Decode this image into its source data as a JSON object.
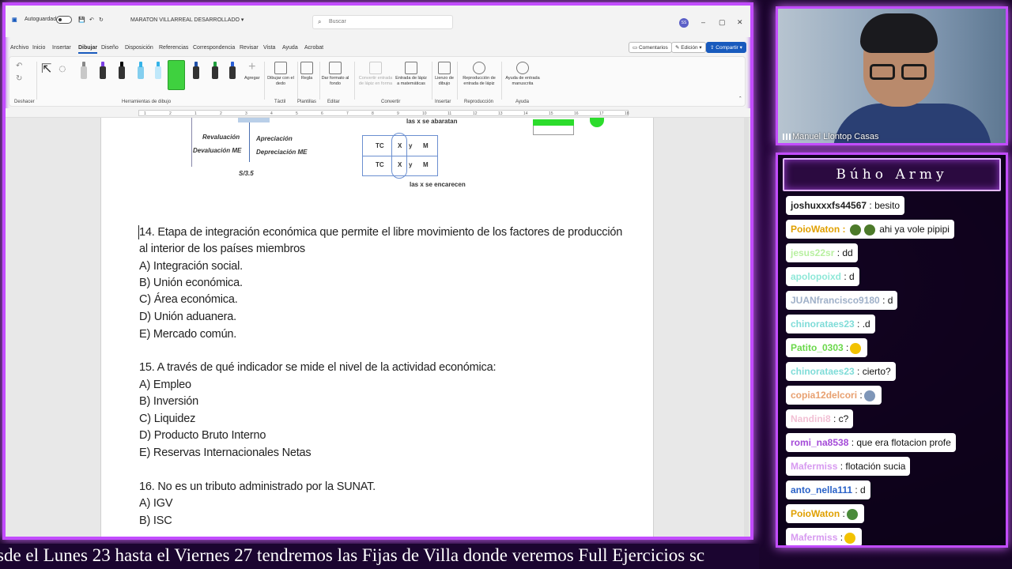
{
  "word": {
    "autosave_label": "Autoguardado",
    "doc_title": "MARATON VILLARREAL DESARROLLADO",
    "search_placeholder": "Buscar",
    "avatar_initials": "SS",
    "menu": [
      "Archivo",
      "Inicio",
      "Insertar",
      "Dibujar",
      "Diseño",
      "Disposición",
      "Referencias",
      "Correspondencia",
      "Revisar",
      "Vista",
      "Ayuda",
      "Acrobat"
    ],
    "active_menu": "Dibujar",
    "comments_label": "Comentarios",
    "edit_label": "Edición",
    "share_label": "Compartir",
    "ribbon": {
      "undo_group": "Deshacer",
      "drawing_tools_group": "Herramientas de dibujo",
      "add_label": "Agregar",
      "draw_finger_label": "Dibujar con el dedo",
      "ruler_label": "Regla",
      "background_format_label": "Dar formato al fondo",
      "ink_to_shape_label": "Convertir entrada de lápiz en forma",
      "ink_to_math_label": "Entrada de lápiz a matemáticas",
      "canvas_label": "Lienzo de dibujo",
      "replay_label": "Reproducción de entrada de lápiz",
      "ink_help_label": "Ayuda de entrada manuscrita",
      "groups": {
        "tactil": "Táctil",
        "plantillas": "Plantillas",
        "editar": "Editar",
        "convertir": "Convertir",
        "insertar": "Insertar",
        "reproduccion": "Reproducción",
        "ayuda": "Ayuda"
      },
      "pen_colors": [
        "#555555",
        "#7b3fe4",
        "#000000",
        "#35b3e8",
        "#35b3e8",
        "#3fd13f",
        "#1e4fa8",
        "#1f9e3c",
        "#2a5fd6"
      ]
    },
    "ruler_numbers": [
      "1",
      "2",
      "1",
      "2",
      "3",
      "4",
      "5",
      "6",
      "7",
      "8",
      "9",
      "10",
      "11",
      "12",
      "13",
      "14",
      "15",
      "16",
      "17",
      "18"
    ],
    "figure": {
      "revaluacion": "Revaluación",
      "devaluacion": "Devaluación ME",
      "apreciacion": "Apreciación",
      "depreciacion": "Depreciación ME",
      "rate": "S/3.5",
      "top_note": "las x se abaratan",
      "bottom_note": "las x se encarecen",
      "row_labels": [
        "TC",
        "X",
        "y",
        "M"
      ]
    },
    "questions": [
      "14. Etapa de integración económica que permite el libre movimiento de los factores de producción",
      "al interior de los países miembros",
      "A) Integración social.",
      "B) Unión económica.",
      "C) Área económica.",
      "D) Unión aduanera.",
      "E) Mercado común.",
      "15. A través de qué indicador se mide el nivel de la actividad económica:",
      "A) Empleo",
      "B) Inversión",
      "C) Liquidez",
      "D) Producto Bruto Interno",
      "E) Reservas Internacionales Netas",
      "16. No es un tributo administrado por la SUNAT.",
      "A) IGV",
      "B) ISC"
    ]
  },
  "webcam": {
    "name": "Manuel Llontop Casas"
  },
  "chat": {
    "title": "Búho Army",
    "messages": [
      {
        "user": "joshuxxxfs44567",
        "color": "#222222",
        "text": ": besito",
        "emotes": []
      },
      {
        "user": "PoioWaton",
        "color": "#e0a000",
        "text": "ahi ya vole pipipi",
        "emotes": [
          "#4c7a2a",
          "#4c7a2a"
        ]
      },
      {
        "user": "jesus22sr",
        "color": "#b8f0a0",
        "text": ": dd",
        "emotes": []
      },
      {
        "user": "apolopoixd",
        "color": "#8fe8d8",
        "text": ": d",
        "emotes": []
      },
      {
        "user": "JUANfrancisco9180",
        "color": "#9fb0c8",
        "text": ": d",
        "emotes": []
      },
      {
        "user": "chinorataes23",
        "color": "#7fdcd8",
        "text": ": .d",
        "emotes": []
      },
      {
        "user": "Patito_0303",
        "color": "#6ad84a",
        "text": ":",
        "emotes": [
          "#f2c200"
        ]
      },
      {
        "user": "chinorataes23",
        "color": "#7fdcd8",
        "text": ": cierto?",
        "emotes": []
      },
      {
        "user": "copia12delcori",
        "color": "#e8a070",
        "text": ":",
        "emotes": [
          "#7e96b8"
        ]
      },
      {
        "user": "Nandini8",
        "color": "#f2c0d4",
        "text": ": c?",
        "emotes": []
      },
      {
        "user": "romi_na8538",
        "color": "#a44ad8",
        "text": ": que era flotacion profe",
        "emotes": []
      },
      {
        "user": "Mafermiss",
        "color": "#d79af0",
        "text": ": flotación sucia",
        "emotes": []
      },
      {
        "user": "anto_nella111",
        "color": "#2a62c8",
        "text": ": d",
        "emotes": []
      },
      {
        "user": "PoioWaton",
        "color": "#e0a000",
        "text": ":",
        "emotes": [
          "#4a8a3a"
        ]
      },
      {
        "user": "Mafermiss",
        "color": "#d79af0",
        "text": ":",
        "emotes": [
          "#f2c200"
        ]
      }
    ]
  },
  "ticker": {
    "text": "sde el Lunes 23 hasta el Viernes 27 tendremos las Fijas de Villa donde veremos Full Ejercicios sc"
  }
}
